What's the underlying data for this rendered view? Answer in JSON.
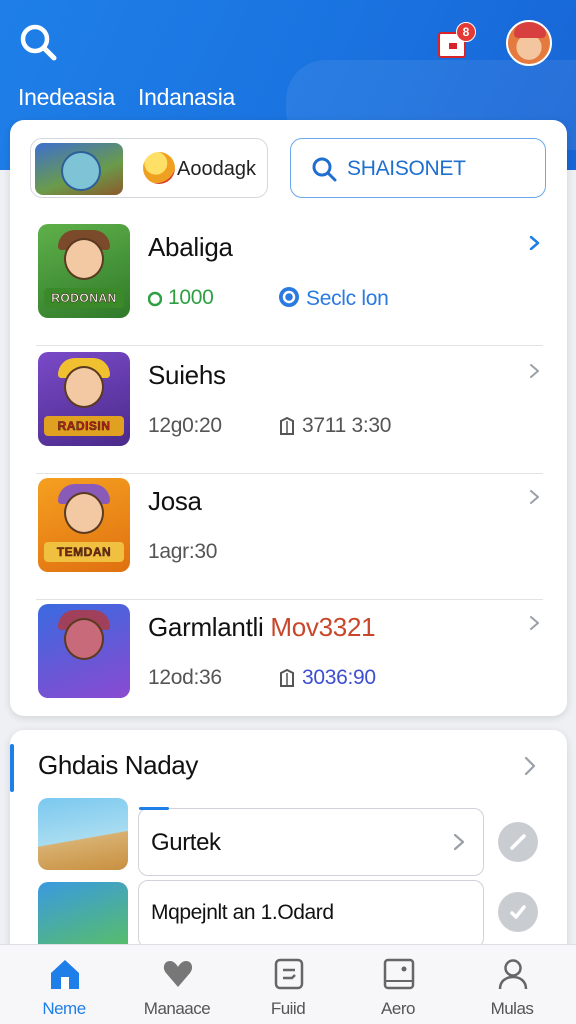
{
  "header": {
    "tabs": [
      {
        "label": "Inedeasia"
      },
      {
        "label": "Indanasia"
      }
    ],
    "notification_badge": "8",
    "colors": {
      "primary": "#1f7fe8",
      "badge": "#e53935"
    }
  },
  "top_card": {
    "chip_label": "Aoodagk",
    "search_label": "SHAISONET",
    "games": [
      {
        "title": "Abaliga",
        "banner": "RODONAN",
        "meta1": "1000",
        "meta2": "Seclc lon"
      },
      {
        "title": "Suiehs",
        "banner": "RADISIN",
        "meta1": "12g0:20",
        "meta2": "3711 3:30"
      },
      {
        "title": "Josa",
        "banner": "TEMDAN",
        "meta1": "1agr:30"
      },
      {
        "title_main": "Garmlantli ",
        "title_highlight": "Mov3321",
        "meta1": "12od:36",
        "meta2": "3036:90"
      }
    ]
  },
  "section": {
    "title": "Ghdais Naday",
    "items": [
      {
        "label": "Gurtek"
      },
      {
        "label": "Mqpejnlt an 1.Odard"
      }
    ]
  },
  "bottom_nav": [
    {
      "label": "Neme",
      "icon": "home-icon",
      "active": true
    },
    {
      "label": "Manaace",
      "icon": "heart-icon"
    },
    {
      "label": "Fuiid",
      "icon": "document-icon"
    },
    {
      "label": "Aero",
      "icon": "image-icon"
    },
    {
      "label": "Mulas",
      "icon": "profile-icon"
    }
  ]
}
